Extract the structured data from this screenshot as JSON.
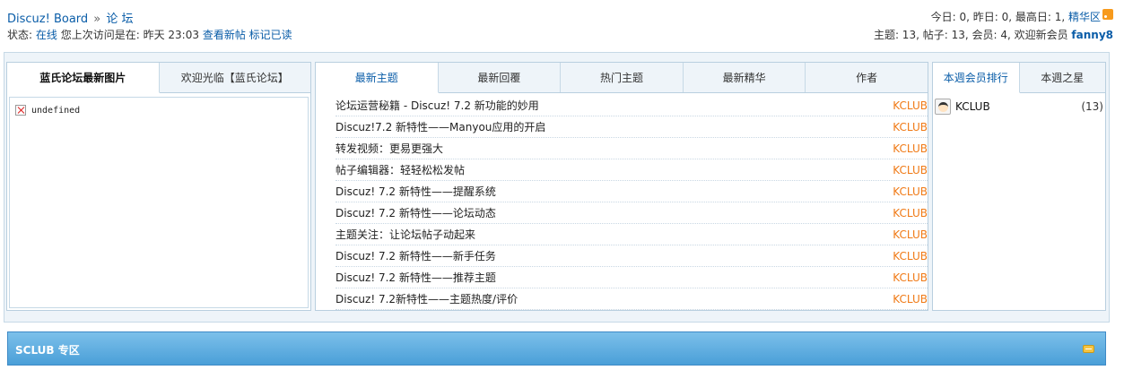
{
  "nav": {
    "board": "Discuz! Board",
    "sep": "»",
    "current": "论 坛"
  },
  "status": {
    "label": "状态:",
    "online": "在线",
    "last_visit": "您上次访问是在:",
    "last_time": "昨天 23:03",
    "view_new": "查看新帖",
    "mark_read": "标记已读"
  },
  "stats": {
    "line1": "今日: 0, 昨日: 0, 最高日: 1,",
    "digest": "精华区",
    "line2": "主题: 13, 帖子: 13, 会员: 4, 欢迎新会员",
    "new_member": "fanny8"
  },
  "left_tabs": [
    "蓝氏论坛最新图片",
    "欢迎光临【蓝氏论坛】"
  ],
  "broken_image_text": "undefined",
  "mid_tabs": [
    "最新主题",
    "最新回覆",
    "热门主题",
    "最新精华",
    "作者"
  ],
  "threads": [
    {
      "title": "论坛运营秘籍 - Discuz! 7.2 新功能的妙用",
      "author": "KCLUB"
    },
    {
      "title": "Discuz!7.2 新特性——Manyou应用的开启",
      "author": "KCLUB"
    },
    {
      "title": "转发视频：更易更强大",
      "author": "KCLUB"
    },
    {
      "title": "帖子编辑器：轻轻松松发帖",
      "author": "KCLUB"
    },
    {
      "title": "Discuz! 7.2 新特性——提醒系统",
      "author": "KCLUB"
    },
    {
      "title": "Discuz! 7.2 新特性——论坛动态",
      "author": "KCLUB"
    },
    {
      "title": "主题关注：让论坛帖子动起来",
      "author": "KCLUB"
    },
    {
      "title": "Discuz! 7.2 新特性——新手任务",
      "author": "KCLUB"
    },
    {
      "title": "Discuz! 7.2 新特性——推荐主题",
      "author": "KCLUB"
    },
    {
      "title": "Discuz! 7.2新特性——主题热度/评价",
      "author": "KCLUB"
    }
  ],
  "right_tabs": [
    "本週会员排行",
    "本週之星"
  ],
  "members": [
    {
      "name": "KCLUB",
      "count": "(13)"
    }
  ],
  "section": {
    "title": "SCLUB 专区"
  },
  "colors": {
    "link": "#0a5da8",
    "author": "#f07a16",
    "section_bar": "#4a9fd8"
  }
}
